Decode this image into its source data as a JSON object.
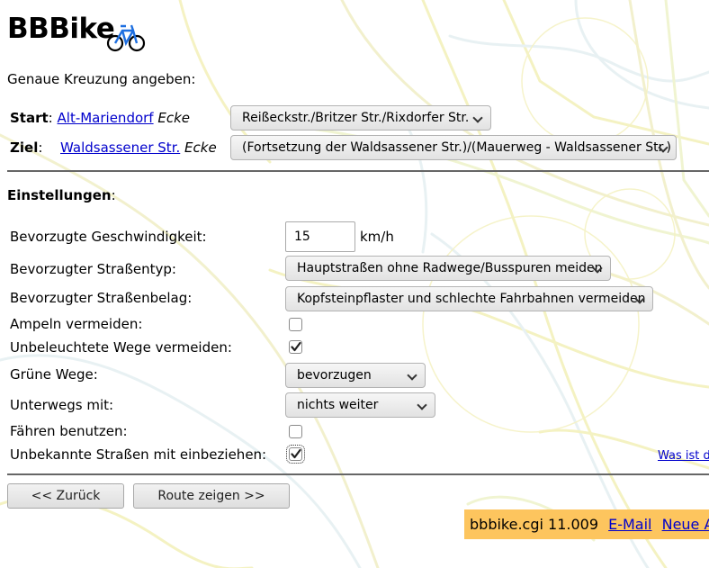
{
  "logo": {
    "text": "BBBike"
  },
  "heading": "Genaue Kreuzung angeben:",
  "start": {
    "label": "Start",
    "colon": ":",
    "street_link": "Alt-Mariendorf",
    "ecke": "Ecke",
    "crossing_selected": "Reißeckstr./Britzer Str./Rixdorfer Str."
  },
  "ziel": {
    "label": "Ziel",
    "colon": ":",
    "street_link": "Waldsassener Str.",
    "ecke": "Ecke",
    "crossing_selected": "(Fortsetzung der Waldsassener Str.)/(Mauerweg - Waldsassener Str.)"
  },
  "settings": {
    "title": "Einstellungen",
    "colon": ":",
    "speed_label": "Bevorzugte Geschwindigkeit:",
    "speed_value": "15",
    "speed_unit": "km/h",
    "street_type_label": "Bevorzugter Straßentyp:",
    "street_type_value": "Hauptstraßen ohne Radwege/Busspuren meiden",
    "surface_label": "Bevorzugter Straßenbelag:",
    "surface_value": "Kopfsteinpflaster und schlechte Fahrbahnen vermeiden",
    "traffic_lights_label": "Ampeln vermeiden:",
    "traffic_lights_checked": false,
    "unlit_label": "Unbeleuchtete Wege vermeiden:",
    "unlit_checked": true,
    "green_label": "Grüne Wege:",
    "green_value": "bevorzugen",
    "transport_label": "Unterwegs mit:",
    "transport_value": "nichts weiter",
    "ferries_label": "Fähren benutzen:",
    "ferries_checked": false,
    "unknown_label": "Unbekannte Straßen mit einbeziehen:",
    "unknown_checked": true,
    "help_link": "Was ist d"
  },
  "buttons": {
    "back": "<< Zurück",
    "route": "Route zeigen >>"
  },
  "footer": {
    "version": "bbbike.cgi 11.009",
    "email": "E-Mail",
    "new": "Neue An"
  },
  "colors": {
    "link": "#0000cc",
    "footer_bg": "#fdc55e",
    "map_lines": "#f3f0b8",
    "map_lines_alt": "#e4eff1"
  },
  "icons": {
    "logo_icon": "bicycle-icon",
    "select_icon": "chevron-down-icon",
    "check_icon": "checkmark-icon"
  }
}
